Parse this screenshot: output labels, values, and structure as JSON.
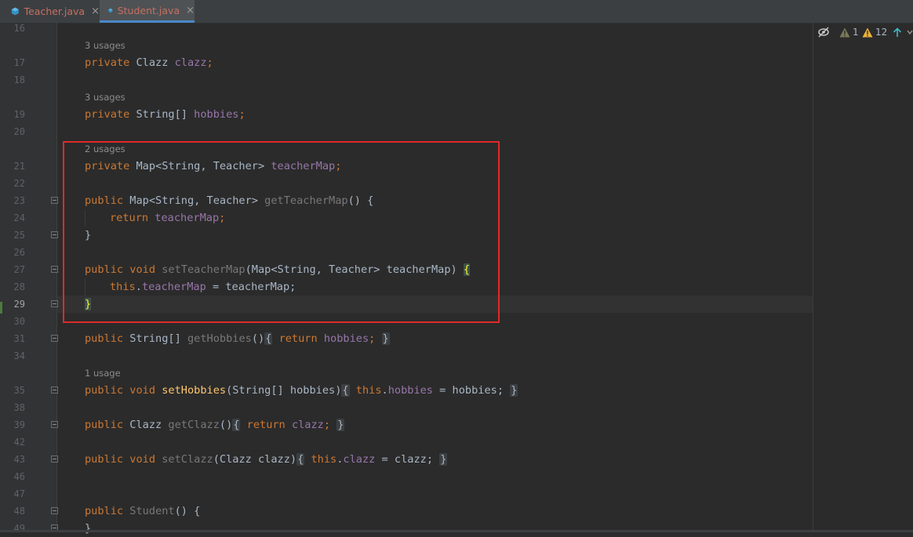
{
  "tabs": [
    {
      "label": "Teacher.java",
      "active": false,
      "icon": "java-class-icon",
      "close": "×"
    },
    {
      "label": "Student.java",
      "active": true,
      "icon": "java-class-icon",
      "close": "×"
    }
  ],
  "colors": {
    "keyword": "#cc7832",
    "field": "#9876aa",
    "method": "#ffc66d",
    "text": "#a9b7c6",
    "highlight_box": "#e0292a",
    "tab_text": "#c76f62"
  },
  "inspections": {
    "hide_icon": "eye-crossed-icon",
    "weak_warnings": "1",
    "warnings": "12",
    "up_icon": "arrow-up-icon",
    "down_icon": "chevron-down-icon"
  },
  "hints": {
    "h17": "3 usages",
    "h19": "3 usages",
    "h21": "2 usages",
    "h35": "1 usage"
  },
  "line_numbers": [
    "16",
    "17",
    "18",
    "19",
    "20",
    "21",
    "22",
    "23",
    "24",
    "25",
    "26",
    "27",
    "28",
    "29",
    "30",
    "31",
    "34",
    "35",
    "38",
    "39",
    "42",
    "43",
    "46",
    "47",
    "48",
    "49"
  ],
  "code": {
    "l17": {
      "kw": "private",
      "type": "Clazz",
      "field": "clazz",
      "semi": ";"
    },
    "l19": {
      "kw": "private",
      "type": "String[]",
      "field": "hobbies",
      "semi": ";"
    },
    "l21": {
      "kw": "private",
      "type": "Map<String, Teacher>",
      "field": "teacherMap",
      "semi": ";"
    },
    "l23": {
      "kw": "public",
      "type": "Map<String, Teacher>",
      "name": "getTeacherMap",
      "rest": "() {"
    },
    "l24": {
      "kw": "return",
      "field": "teacherMap",
      "semi": ";"
    },
    "l25": {
      "text": "}"
    },
    "l27": {
      "kw": "public void",
      "name": "setTeacherMap",
      "rest": "(Map<String, Teacher> teacherMap) ",
      "open": "{"
    },
    "l28": {
      "kw": "this",
      "dot": ".",
      "field": "teacherMap",
      "rest": " = teacherMap;"
    },
    "l29": {
      "text": "}"
    },
    "l31": {
      "kw": "public",
      "type": "String[]",
      "name": "getHobbies",
      "paren": "()",
      "fold_open": "{",
      "kw2": "return",
      "field": "hobbies",
      "semi": ";",
      "fold_close": "}"
    },
    "l35": {
      "kw": "public void",
      "name": "setHobbies",
      "params": "(String[] hobbies)",
      "fold_open": "{",
      "kw2": "this",
      "dot": ".",
      "field": "hobbies",
      "rest": " = hobbies;",
      "fold_close": "}"
    },
    "l39": {
      "kw": "public",
      "type": "Clazz",
      "name": "getClazz",
      "paren": "()",
      "fold_open": "{",
      "kw2": "return",
      "field": "clazz",
      "semi": ";",
      "fold_close": "}"
    },
    "l43": {
      "kw": "public void",
      "name": "setClazz",
      "params": "(Clazz clazz)",
      "fold_open": "{",
      "kw2": "this",
      "dot": ".",
      "field": "clazz",
      "rest": " = clazz;",
      "fold_close": "}"
    },
    "l48": {
      "kw": "public",
      "name": "Student",
      "rest": "() {"
    },
    "l49": {
      "text": "}"
    }
  }
}
